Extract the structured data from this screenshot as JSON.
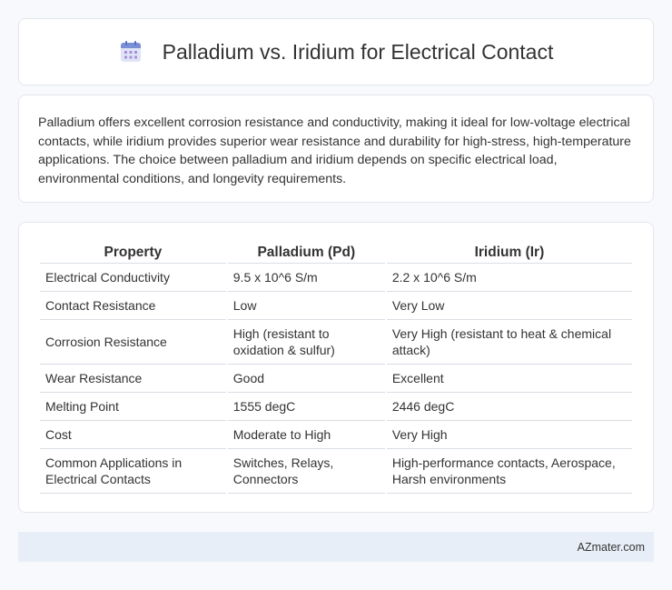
{
  "header": {
    "title": "Palladium vs. Iridium for Electrical Contact",
    "icon": "calendar-grid-icon",
    "icon_colors": {
      "top": "#7b8fd6",
      "body": "#dfe4f7",
      "dots": "#a98fdc"
    }
  },
  "intro": {
    "text": "Palladium offers excellent corrosion resistance and conductivity, making it ideal for low-voltage electrical contacts, while iridium provides superior wear resistance and durability for high-stress, high-temperature applications. The choice between palladium and iridium depends on specific electrical load, environmental conditions, and longevity requirements."
  },
  "table": {
    "headers": [
      "Property",
      "Palladium (Pd)",
      "Iridium (Ir)"
    ],
    "rows": [
      [
        "Electrical Conductivity",
        "9.5 x 10^6 S/m",
        "2.2 x 10^6 S/m"
      ],
      [
        "Contact Resistance",
        "Low",
        "Very Low"
      ],
      [
        "Corrosion Resistance",
        "High (resistant to oxidation & sulfur)",
        "Very High (resistant to heat & chemical attack)"
      ],
      [
        "Wear Resistance",
        "Good",
        "Excellent"
      ],
      [
        "Melting Point",
        "1555 degC",
        "2446 degC"
      ],
      [
        "Cost",
        "Moderate to High",
        "Very High"
      ],
      [
        "Common Applications in Electrical Contacts",
        "Switches, Relays, Connectors",
        "High-performance contacts, Aerospace, Harsh environments"
      ]
    ]
  },
  "footer": {
    "brand": "AZmater.com"
  },
  "colors": {
    "page_bg": "#f8f9fc",
    "card_border": "#e3e6ec",
    "footer_bg": "#e8eef8",
    "text": "#333333"
  }
}
